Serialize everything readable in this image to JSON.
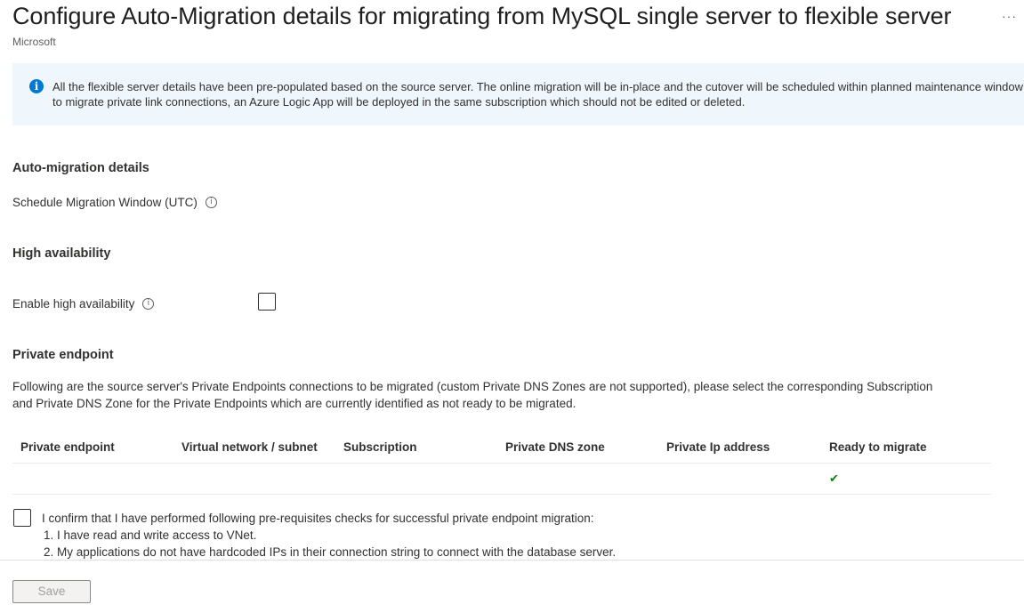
{
  "header": {
    "title": "Configure Auto-Migration details for migrating from MySQL single server to flexible server",
    "publisher": "Microsoft",
    "more_label": "···"
  },
  "info_banner": {
    "icon": "info-icon",
    "icon_glyph": "i",
    "line1": "All the flexible server details have been pre-populated based on the source server. The online migration will be in-place and the cutover will be scheduled within planned maintenance window",
    "line2": "to migrate private link connections, an Azure Logic App will be deployed in the same subscription which should not be edited or deleted.",
    "color": "#0078d4"
  },
  "auto_migration": {
    "heading": "Auto-migration details",
    "schedule_label": "Schedule Migration Window (UTC)",
    "tooltip_glyph": "i"
  },
  "high_availability": {
    "heading": "High availability",
    "enable_label": "Enable high availability",
    "tooltip_glyph": "i",
    "checked": false
  },
  "private_endpoint": {
    "heading": "Private endpoint",
    "description_line1": "Following are the source server's Private Endpoints connections to be migrated (custom Private DNS Zones are not supported), please select the corresponding Subscription",
    "description_line2": "and Private DNS Zone for the Private Endpoints which are currently identified as not ready to be migrated.",
    "table": {
      "columns": [
        "Private endpoint",
        "Virtual network / subnet",
        "Subscription",
        "Private DNS zone",
        "Private Ip address",
        "Ready to migrate"
      ],
      "rows": [
        {
          "private_endpoint": "",
          "virtual_network_subnet": "",
          "subscription": "",
          "private_dns_zone": "",
          "private_ip_address": "",
          "ready_to_migrate": "✔"
        }
      ]
    },
    "status_color": "#107c10"
  },
  "confirmation": {
    "checked": false,
    "line1": "I confirm that I have performed following pre-requisites checks for successful private endpoint migration:",
    "line2": "1. I have read and write access to VNet.",
    "line3": "2. My applications do not have hardcoded IPs in their connection string to connect with the database server."
  },
  "footer": {
    "save_label": "Save",
    "save_disabled": true
  }
}
